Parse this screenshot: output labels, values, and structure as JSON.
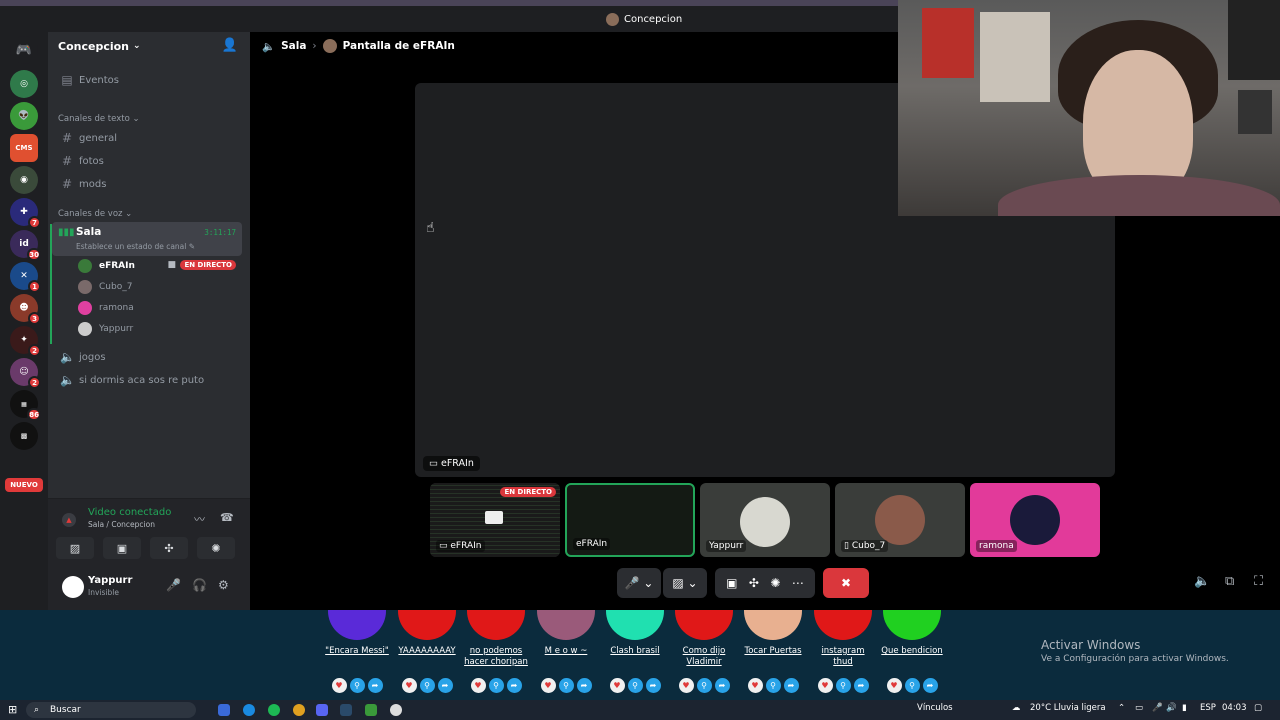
{
  "window": {
    "title": "Concepcion"
  },
  "server": {
    "name": "Concepcion"
  },
  "sidebar": {
    "events": "Eventos",
    "text_category": "Canales de texto",
    "text_channels": [
      "general",
      "fotos",
      "mods"
    ],
    "voice_category": "Canales de voz",
    "active_voice": {
      "name": "Sala",
      "status": "Establece un estado de canal",
      "timer": "3:11:17"
    },
    "voice_users": [
      {
        "name": "eFRAIn",
        "live": true,
        "live_label": "EN DIRECTO",
        "color": "#3a7a3a"
      },
      {
        "name": "Cubo_7",
        "live": false,
        "color": "#7a6a6a"
      },
      {
        "name": "ramona",
        "live": false,
        "color": "#e040a0"
      },
      {
        "name": "Yappurr",
        "live": false,
        "color": "#cccccc"
      }
    ],
    "other_voice": [
      "jogos",
      "si dormis aca sos re puto"
    ]
  },
  "rail": {
    "badges": [
      "7",
      "30",
      "1",
      "3",
      "2",
      "2",
      "86"
    ],
    "new_label": "NUEVO"
  },
  "voice_panel": {
    "title": "Video conectado",
    "subtitle": "Sala / Concepcion"
  },
  "user_panel": {
    "name": "Yappurr",
    "status": "Invisible"
  },
  "stage": {
    "channel": "Sala",
    "screen_title": "Pantalla de eFRAIn",
    "main_label": "eFRAIn",
    "tiles": [
      {
        "name": "eFRAIn",
        "live_label": "EN DIRECTO"
      },
      {
        "name": "eFRAIn"
      },
      {
        "name": "Yappurr"
      },
      {
        "name": "Cubo_7"
      },
      {
        "name": "ramona"
      }
    ]
  },
  "soundboard": {
    "items": [
      {
        "label": "\"Encara Messi\"",
        "color": "#5a2ad8"
      },
      {
        "label": "YAAAAAAAAY",
        "color": "#e01818"
      },
      {
        "label": "no podemos hacer choripan",
        "color": "#e01818"
      },
      {
        "label": "M e o w ~",
        "color": "#9a5a7a"
      },
      {
        "label": "Clash brasil",
        "color": "#20e0b0"
      },
      {
        "label": "Como dijo Vladimir",
        "color": "#e01818"
      },
      {
        "label": "Tocar Puertas",
        "color": "#e8b090"
      },
      {
        "label": "instagram thud",
        "color": "#e01818"
      },
      {
        "label": "Que bendicion",
        "color": "#20d020"
      }
    ]
  },
  "watermark": {
    "title": "Activar Windows",
    "subtitle": "Ve a Configuración para activar Windows."
  },
  "taskbar": {
    "search": "Buscar",
    "links": "Vínculos",
    "weather": "20°C  Lluvia ligera",
    "lang": "ESP",
    "time": "04:03"
  }
}
